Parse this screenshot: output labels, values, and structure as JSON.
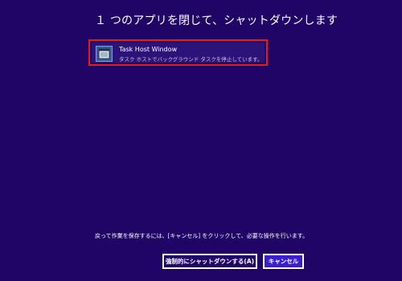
{
  "dialog": {
    "title": "１ つのアプリを閉じて、シャットダウンします",
    "note": "戻って作業を保存するには、[キャンセル] をクリックして、必要な操作を行います。"
  },
  "apps": [
    {
      "name": "Task Host Window",
      "description": "タスク ホストでバックグラウンド タスクを停止しています。",
      "icon": "window-app-icon"
    }
  ],
  "buttons": {
    "force_shutdown_label": "強制的にシャットダウンする(A)",
    "cancel_label": "キャンセル"
  },
  "colors": {
    "background": "#210566",
    "selection_border": "#e31d1d",
    "cancel_button": "#3b1fcf"
  }
}
